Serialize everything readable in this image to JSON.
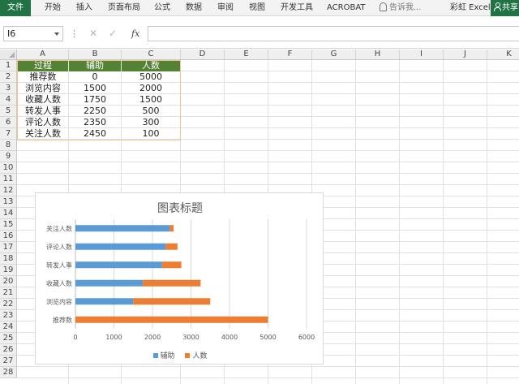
{
  "ribbon": {
    "file_tab": "文件",
    "tabs": [
      "开始",
      "插入",
      "页面布局",
      "公式",
      "数据",
      "审阅",
      "视图",
      "开发工具",
      "ACROBAT"
    ],
    "tell_me": "告诉我...",
    "user": "彩虹 Excel",
    "share": "共享"
  },
  "formula_bar": {
    "name_box": "I6",
    "fx": "fx",
    "cancel_icon": "close-icon",
    "enter_icon": "check-icon",
    "formula": ""
  },
  "columns": [
    "A",
    "B",
    "C",
    "D",
    "E",
    "F",
    "G",
    "H",
    "I",
    "J",
    "K"
  ],
  "rows": [
    "1",
    "2",
    "3",
    "4",
    "5",
    "6",
    "7",
    "8",
    "9",
    "10",
    "11",
    "12",
    "13",
    "14",
    "15",
    "16",
    "17",
    "18",
    "19",
    "20",
    "21",
    "22",
    "23",
    "24",
    "25",
    "26",
    "27",
    "28"
  ],
  "table": {
    "header": [
      "过程",
      "辅助",
      "人数"
    ],
    "rows": [
      [
        "推荐数",
        "0",
        "5000"
      ],
      [
        "浏览内容",
        "1500",
        "2000"
      ],
      [
        "收藏人数",
        "1750",
        "1500"
      ],
      [
        "转发人事",
        "2250",
        "500"
      ],
      [
        "评论人数",
        "2350",
        "300"
      ],
      [
        "关注人数",
        "2450",
        "100"
      ]
    ]
  },
  "colors": {
    "header_fill": "#548235",
    "series_helper": "#5B9BD5",
    "series_people": "#ED7D31",
    "table_border": "#F2C48A"
  },
  "chart_data": {
    "type": "bar",
    "orientation": "horizontal",
    "stacked": true,
    "title": "图表标题",
    "categories": [
      "推荐数",
      "浏览内容",
      "收藏人数",
      "转发人事",
      "评论人数",
      "关注人数"
    ],
    "series": [
      {
        "name": "辅助",
        "values": [
          0,
          1500,
          1750,
          2250,
          2350,
          2450
        ],
        "color": "#5B9BD5"
      },
      {
        "name": "人数",
        "values": [
          5000,
          2000,
          1500,
          500,
          300,
          100
        ],
        "color": "#ED7D31"
      }
    ],
    "xlim": [
      0,
      6000
    ],
    "xticks": [
      0,
      1000,
      2000,
      3000,
      4000,
      5000,
      6000
    ],
    "grid": true,
    "legend": "bottom"
  }
}
